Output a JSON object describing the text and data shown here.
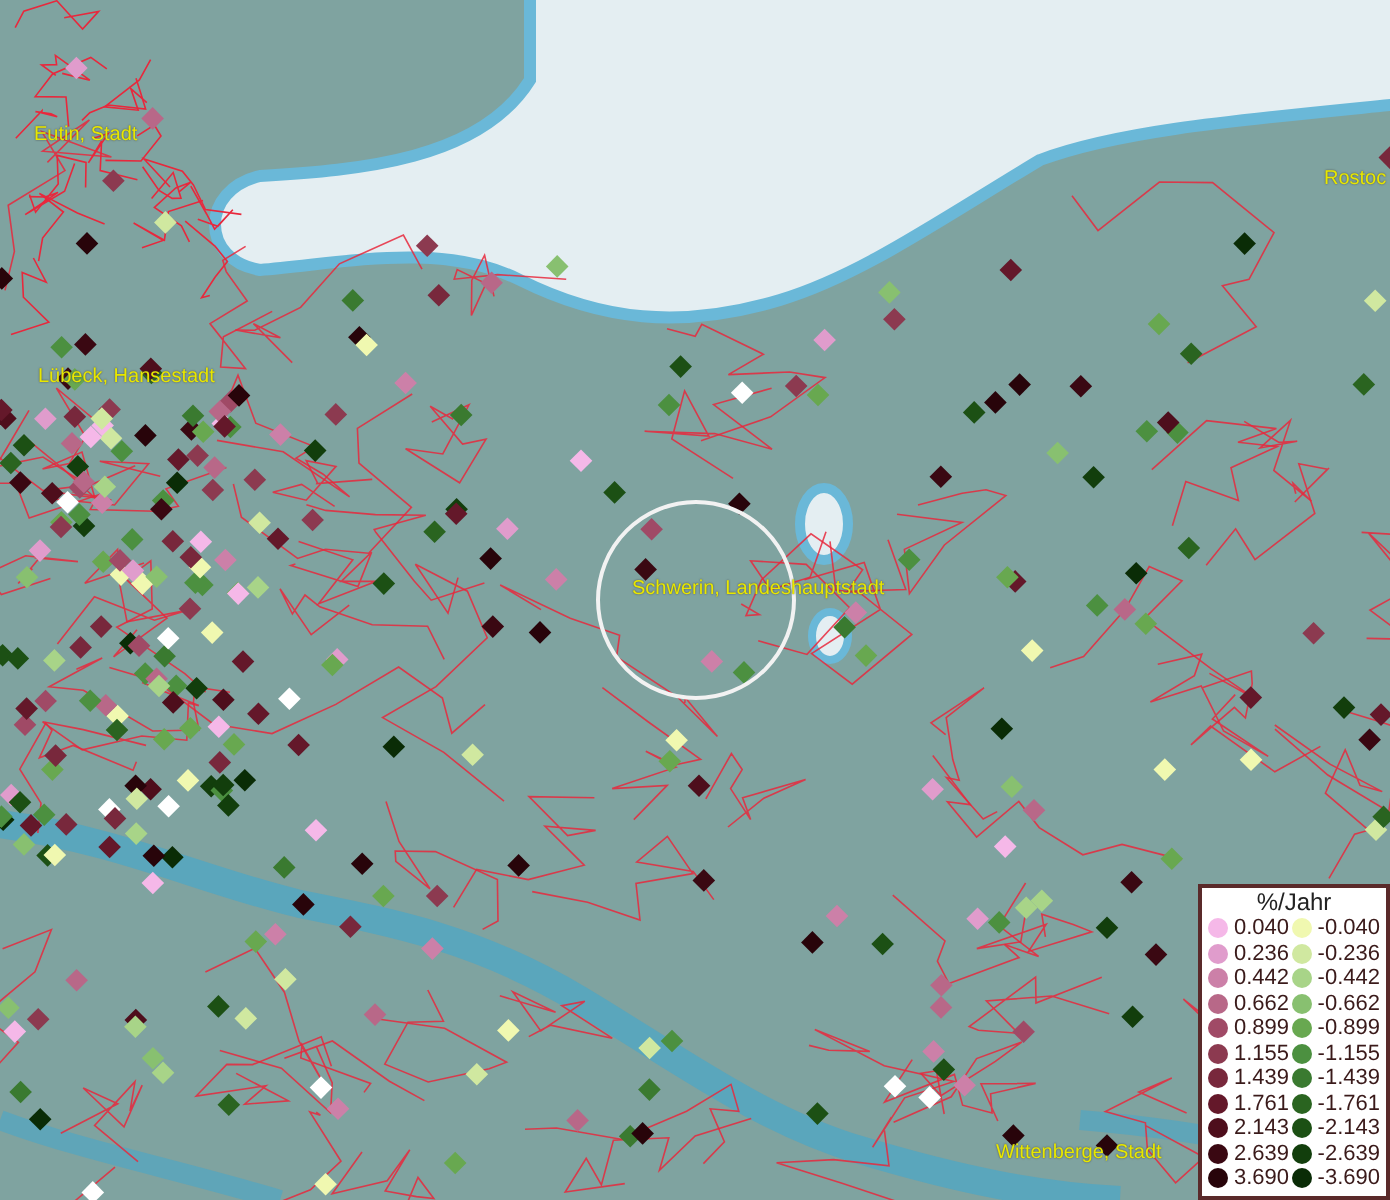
{
  "map_labels": [
    {
      "text": "Eutin, Stadt"
    },
    {
      "text": "Lübeck, Hansestadt"
    },
    {
      "text": "Schwerin, Landeshauptstadt"
    },
    {
      "text": "Rostoc"
    },
    {
      "text": "Wittenberge, Stadt"
    }
  ],
  "legend": {
    "title": "%/Jahr",
    "positive": [
      {
        "value": "0.040",
        "color": "#f5b8e8"
      },
      {
        "value": "0.236",
        "color": "#e09ccc"
      },
      {
        "value": "0.442",
        "color": "#cc80a8"
      },
      {
        "value": "0.662",
        "color": "#b86888"
      },
      {
        "value": "0.899",
        "color": "#a04a66"
      },
      {
        "value": "1.155",
        "color": "#8c3a50"
      },
      {
        "value": "1.439",
        "color": "#78283c"
      },
      {
        "value": "1.761",
        "color": "#64182a"
      },
      {
        "value": "2.143",
        "color": "#4e0e1c"
      },
      {
        "value": "2.639",
        "color": "#3a0812"
      },
      {
        "value": "3.690",
        "color": "#28040a"
      }
    ],
    "negative": [
      {
        "value": "-0.040",
        "color": "#f0f8b0"
      },
      {
        "value": "-0.236",
        "color": "#d0e8a0"
      },
      {
        "value": "-0.442",
        "color": "#a8d488"
      },
      {
        "value": "-0.662",
        "color": "#88c070"
      },
      {
        "value": "-0.899",
        "color": "#68a850"
      },
      {
        "value": "-1.155",
        "color": "#4c9040"
      },
      {
        "value": "-1.439",
        "color": "#3a7a30"
      },
      {
        "value": "-1.761",
        "color": "#2a6420"
      },
      {
        "value": "-2.143",
        "color": "#1c5014"
      },
      {
        "value": "-2.639",
        "color": "#123e0c"
      },
      {
        "value": "-3.690",
        "color": "#0a2c06"
      }
    ]
  }
}
